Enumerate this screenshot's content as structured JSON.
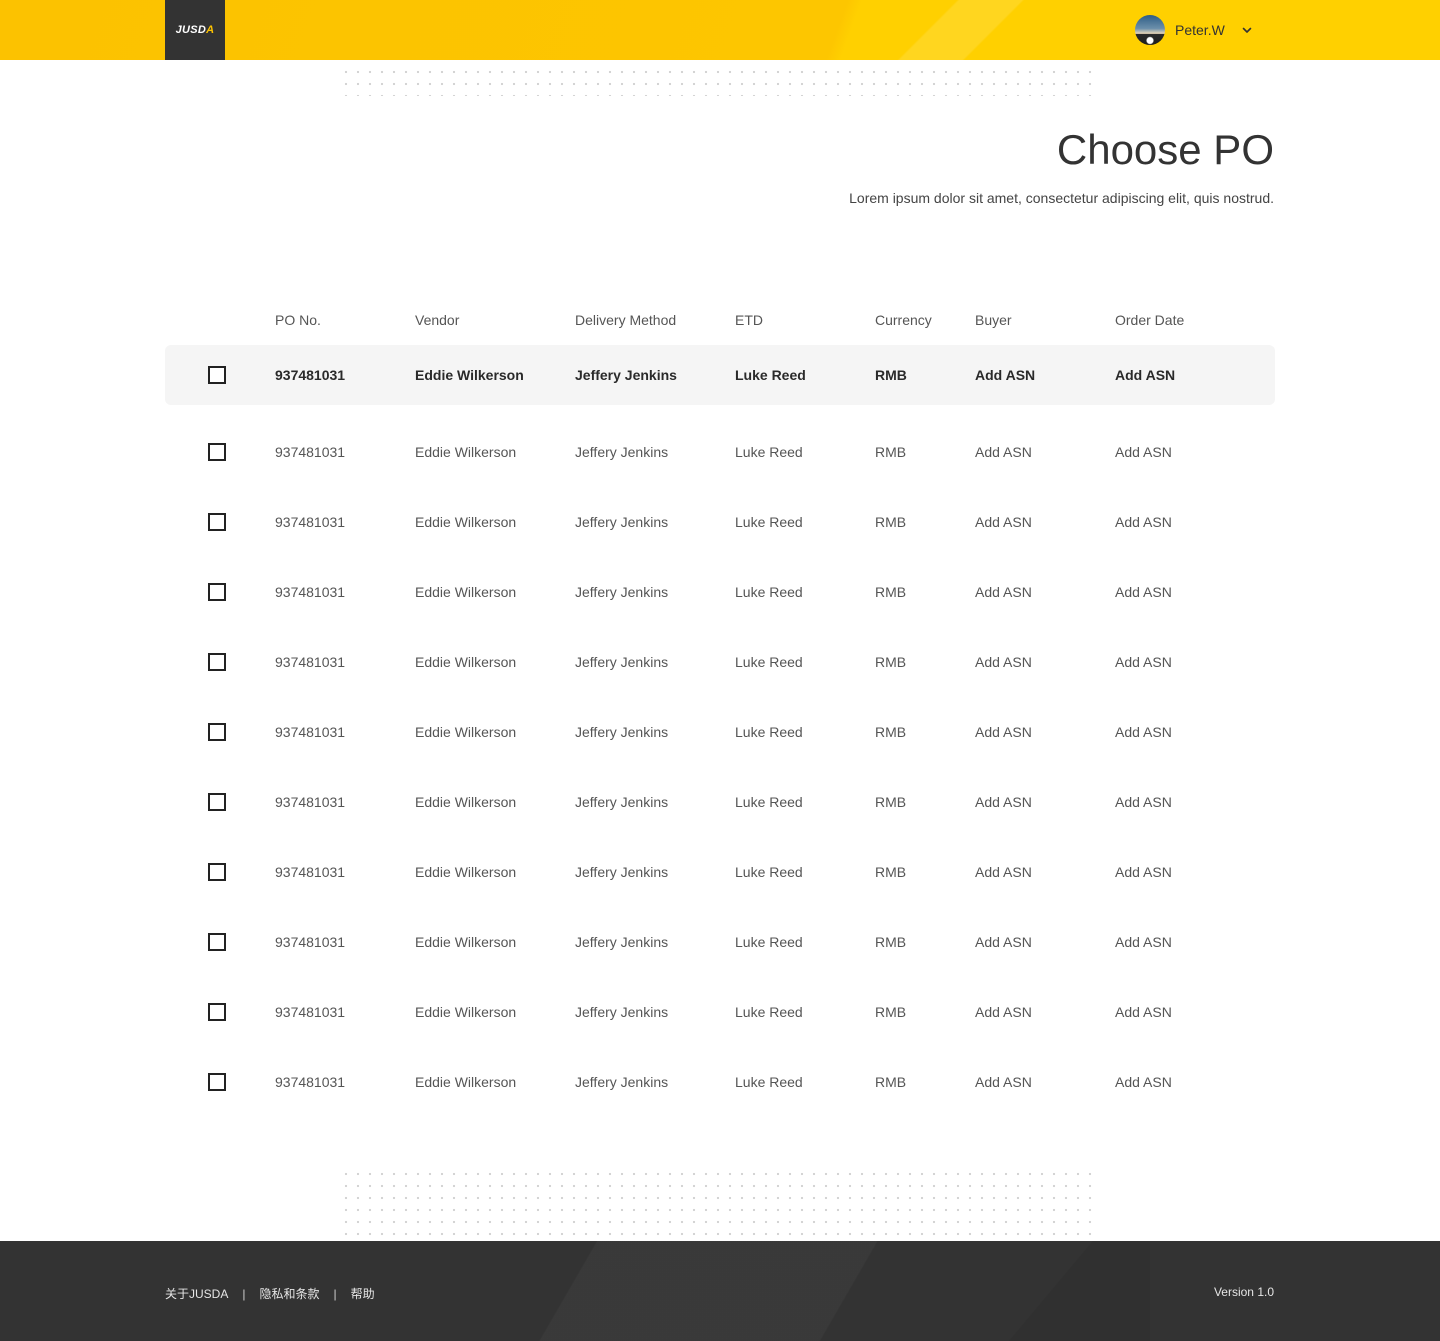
{
  "header": {
    "logo_text_main": "JUSD",
    "logo_text_accent": "A",
    "user_name": "Peter.W"
  },
  "page": {
    "title": "Choose PO",
    "subtitle": "Lorem ipsum dolor sit amet, consectetur adipiscing elit, quis nostrud."
  },
  "table": {
    "columns": [
      "PO No.",
      "Vendor",
      "Delivery Method",
      "ETD",
      "Currency",
      "Buyer",
      "Order Date"
    ],
    "rows": [
      {
        "po": "937481031",
        "vendor": "Eddie Wilkerson",
        "delivery": "Jeffery Jenkins",
        "etd": "Luke Reed",
        "currency": "RMB",
        "buyer": "Add ASN",
        "order_date": "Add ASN"
      },
      {
        "po": "937481031",
        "vendor": "Eddie Wilkerson",
        "delivery": "Jeffery Jenkins",
        "etd": "Luke Reed",
        "currency": "RMB",
        "buyer": "Add ASN",
        "order_date": "Add ASN"
      },
      {
        "po": "937481031",
        "vendor": "Eddie Wilkerson",
        "delivery": "Jeffery Jenkins",
        "etd": "Luke Reed",
        "currency": "RMB",
        "buyer": "Add ASN",
        "order_date": "Add ASN"
      },
      {
        "po": "937481031",
        "vendor": "Eddie Wilkerson",
        "delivery": "Jeffery Jenkins",
        "etd": "Luke Reed",
        "currency": "RMB",
        "buyer": "Add ASN",
        "order_date": "Add ASN"
      },
      {
        "po": "937481031",
        "vendor": "Eddie Wilkerson",
        "delivery": "Jeffery Jenkins",
        "etd": "Luke Reed",
        "currency": "RMB",
        "buyer": "Add ASN",
        "order_date": "Add ASN"
      },
      {
        "po": "937481031",
        "vendor": "Eddie Wilkerson",
        "delivery": "Jeffery Jenkins",
        "etd": "Luke Reed",
        "currency": "RMB",
        "buyer": "Add ASN",
        "order_date": "Add ASN"
      },
      {
        "po": "937481031",
        "vendor": "Eddie Wilkerson",
        "delivery": "Jeffery Jenkins",
        "etd": "Luke Reed",
        "currency": "RMB",
        "buyer": "Add ASN",
        "order_date": "Add ASN"
      },
      {
        "po": "937481031",
        "vendor": "Eddie Wilkerson",
        "delivery": "Jeffery Jenkins",
        "etd": "Luke Reed",
        "currency": "RMB",
        "buyer": "Add ASN",
        "order_date": "Add ASN"
      },
      {
        "po": "937481031",
        "vendor": "Eddie Wilkerson",
        "delivery": "Jeffery Jenkins",
        "etd": "Luke Reed",
        "currency": "RMB",
        "buyer": "Add ASN",
        "order_date": "Add ASN"
      },
      {
        "po": "937481031",
        "vendor": "Eddie Wilkerson",
        "delivery": "Jeffery Jenkins",
        "etd": "Luke Reed",
        "currency": "RMB",
        "buyer": "Add ASN",
        "order_date": "Add ASN"
      },
      {
        "po": "937481031",
        "vendor": "Eddie Wilkerson",
        "delivery": "Jeffery Jenkins",
        "etd": "Luke Reed",
        "currency": "RMB",
        "buyer": "Add ASN",
        "order_date": "Add ASN"
      }
    ]
  },
  "footer": {
    "links": [
      "关于JUSDA",
      "隐私和条款",
      "帮助"
    ],
    "separator": "|",
    "version": "Version 1.0"
  },
  "colors": {
    "header_yellow": "#fcc200",
    "dark": "#333333",
    "row_highlight": "#f5f5f5"
  },
  "icons": {
    "user_menu": "chevron-down-icon",
    "row_select": "checkbox-icon"
  }
}
